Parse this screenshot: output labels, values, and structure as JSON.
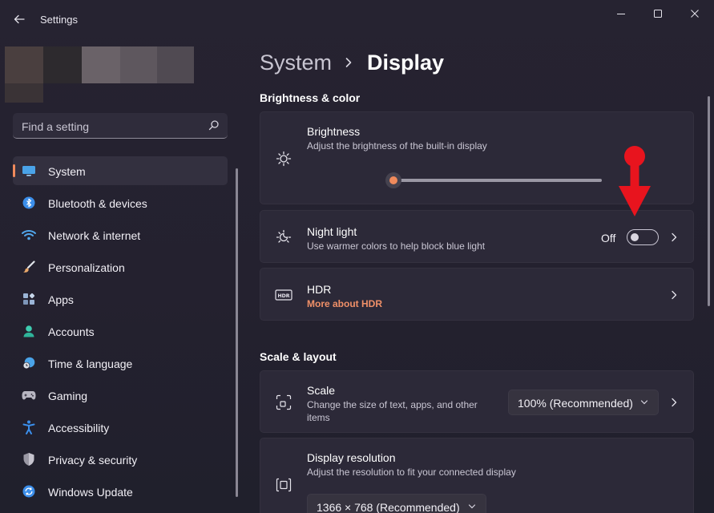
{
  "window": {
    "title": "Settings",
    "back_icon": "back-arrow-icon",
    "controls": [
      "minimize-icon",
      "maximize-icon",
      "close-icon"
    ]
  },
  "sidebar": {
    "search_placeholder": "Find a setting",
    "items": [
      {
        "label": "System",
        "icon": "monitor-icon",
        "active": true,
        "color": "#4aa3e8"
      },
      {
        "label": "Bluetooth & devices",
        "icon": "bluetooth-icon",
        "active": false,
        "color": "#3b8eea"
      },
      {
        "label": "Network & internet",
        "icon": "wifi-icon",
        "active": false,
        "color": "#52a8ee"
      },
      {
        "label": "Personalization",
        "icon": "brush-icon",
        "active": false,
        "color": "#e9a86b"
      },
      {
        "label": "Apps",
        "icon": "apps-icon",
        "active": false,
        "color": "#9ab4d6"
      },
      {
        "label": "Accounts",
        "icon": "person-icon",
        "active": false,
        "color": "#3ecdb0"
      },
      {
        "label": "Time & language",
        "icon": "globe-clock-icon",
        "active": false,
        "color": "#4aa3e8"
      },
      {
        "label": "Gaming",
        "icon": "gamepad-icon",
        "active": false,
        "color": "#b8b6c2"
      },
      {
        "label": "Accessibility",
        "icon": "accessibility-icon",
        "active": false,
        "color": "#3b8eea"
      },
      {
        "label": "Privacy & security",
        "icon": "shield-icon",
        "active": false,
        "color": "#9a98a4"
      },
      {
        "label": "Windows Update",
        "icon": "update-icon",
        "active": false,
        "color": "#3b8eea"
      }
    ]
  },
  "breadcrumb": {
    "parent": "System",
    "current": "Display"
  },
  "sections": {
    "brightness_color": "Brightness & color",
    "scale_layout": "Scale & layout"
  },
  "cards": {
    "brightness": {
      "title": "Brightness",
      "subtitle": "Adjust the brightness of the built-in display",
      "icon": "sun-icon",
      "level": 0
    },
    "night_light": {
      "title": "Night light",
      "subtitle": "Use warmer colors to help block blue light",
      "icon": "night-light-icon",
      "toggle_label": "Off",
      "on": false
    },
    "hdr": {
      "title": "HDR",
      "link": "More about HDR",
      "icon": "hdr-icon"
    },
    "scale": {
      "title": "Scale",
      "subtitle_line1": "Change the size of text, apps, and other",
      "subtitle_line2": "items",
      "icon": "scale-icon",
      "value": "100% (Recommended)"
    },
    "resolution": {
      "title": "Display resolution",
      "subtitle": "Adjust the resolution to fit your connected display",
      "icon": "resolution-icon",
      "value": "1366 × 768 (Recommended)"
    }
  },
  "colors": {
    "accent": "#f08a5c",
    "annotation_arrow": "#e8141e"
  }
}
